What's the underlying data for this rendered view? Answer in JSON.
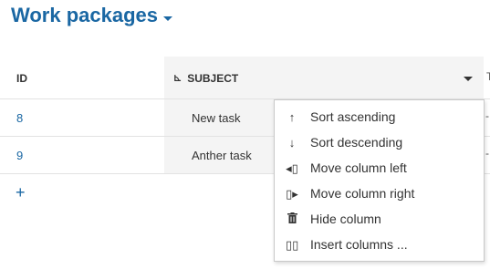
{
  "page": {
    "title": "Work packages"
  },
  "table": {
    "headers": {
      "id": "ID",
      "subject": "SUBJECT"
    },
    "rows": [
      {
        "id": "8",
        "subject": "New task"
      },
      {
        "id": "9",
        "subject": "Anther task"
      }
    ],
    "add_label": "+"
  },
  "column_menu": {
    "items": [
      {
        "label": "Sort ascending",
        "icon": "sort-ascending-icon",
        "glyph": "↑"
      },
      {
        "label": "Sort descending",
        "icon": "sort-descending-icon",
        "glyph": "↓"
      },
      {
        "label": "Move column left",
        "icon": "move-left-icon",
        "glyph": "◂⃞"
      },
      {
        "label": "Move column right",
        "icon": "move-right-icon",
        "glyph": "⃞▸"
      },
      {
        "label": "Hide column",
        "icon": "trash-icon",
        "glyph": "🗑"
      },
      {
        "label": "Insert columns ...",
        "icon": "insert-columns-icon",
        "glyph": "▯▯"
      }
    ]
  },
  "colors": {
    "accent": "#1a67a3",
    "text": "#333333",
    "header_bg": "#f4f4f4"
  }
}
